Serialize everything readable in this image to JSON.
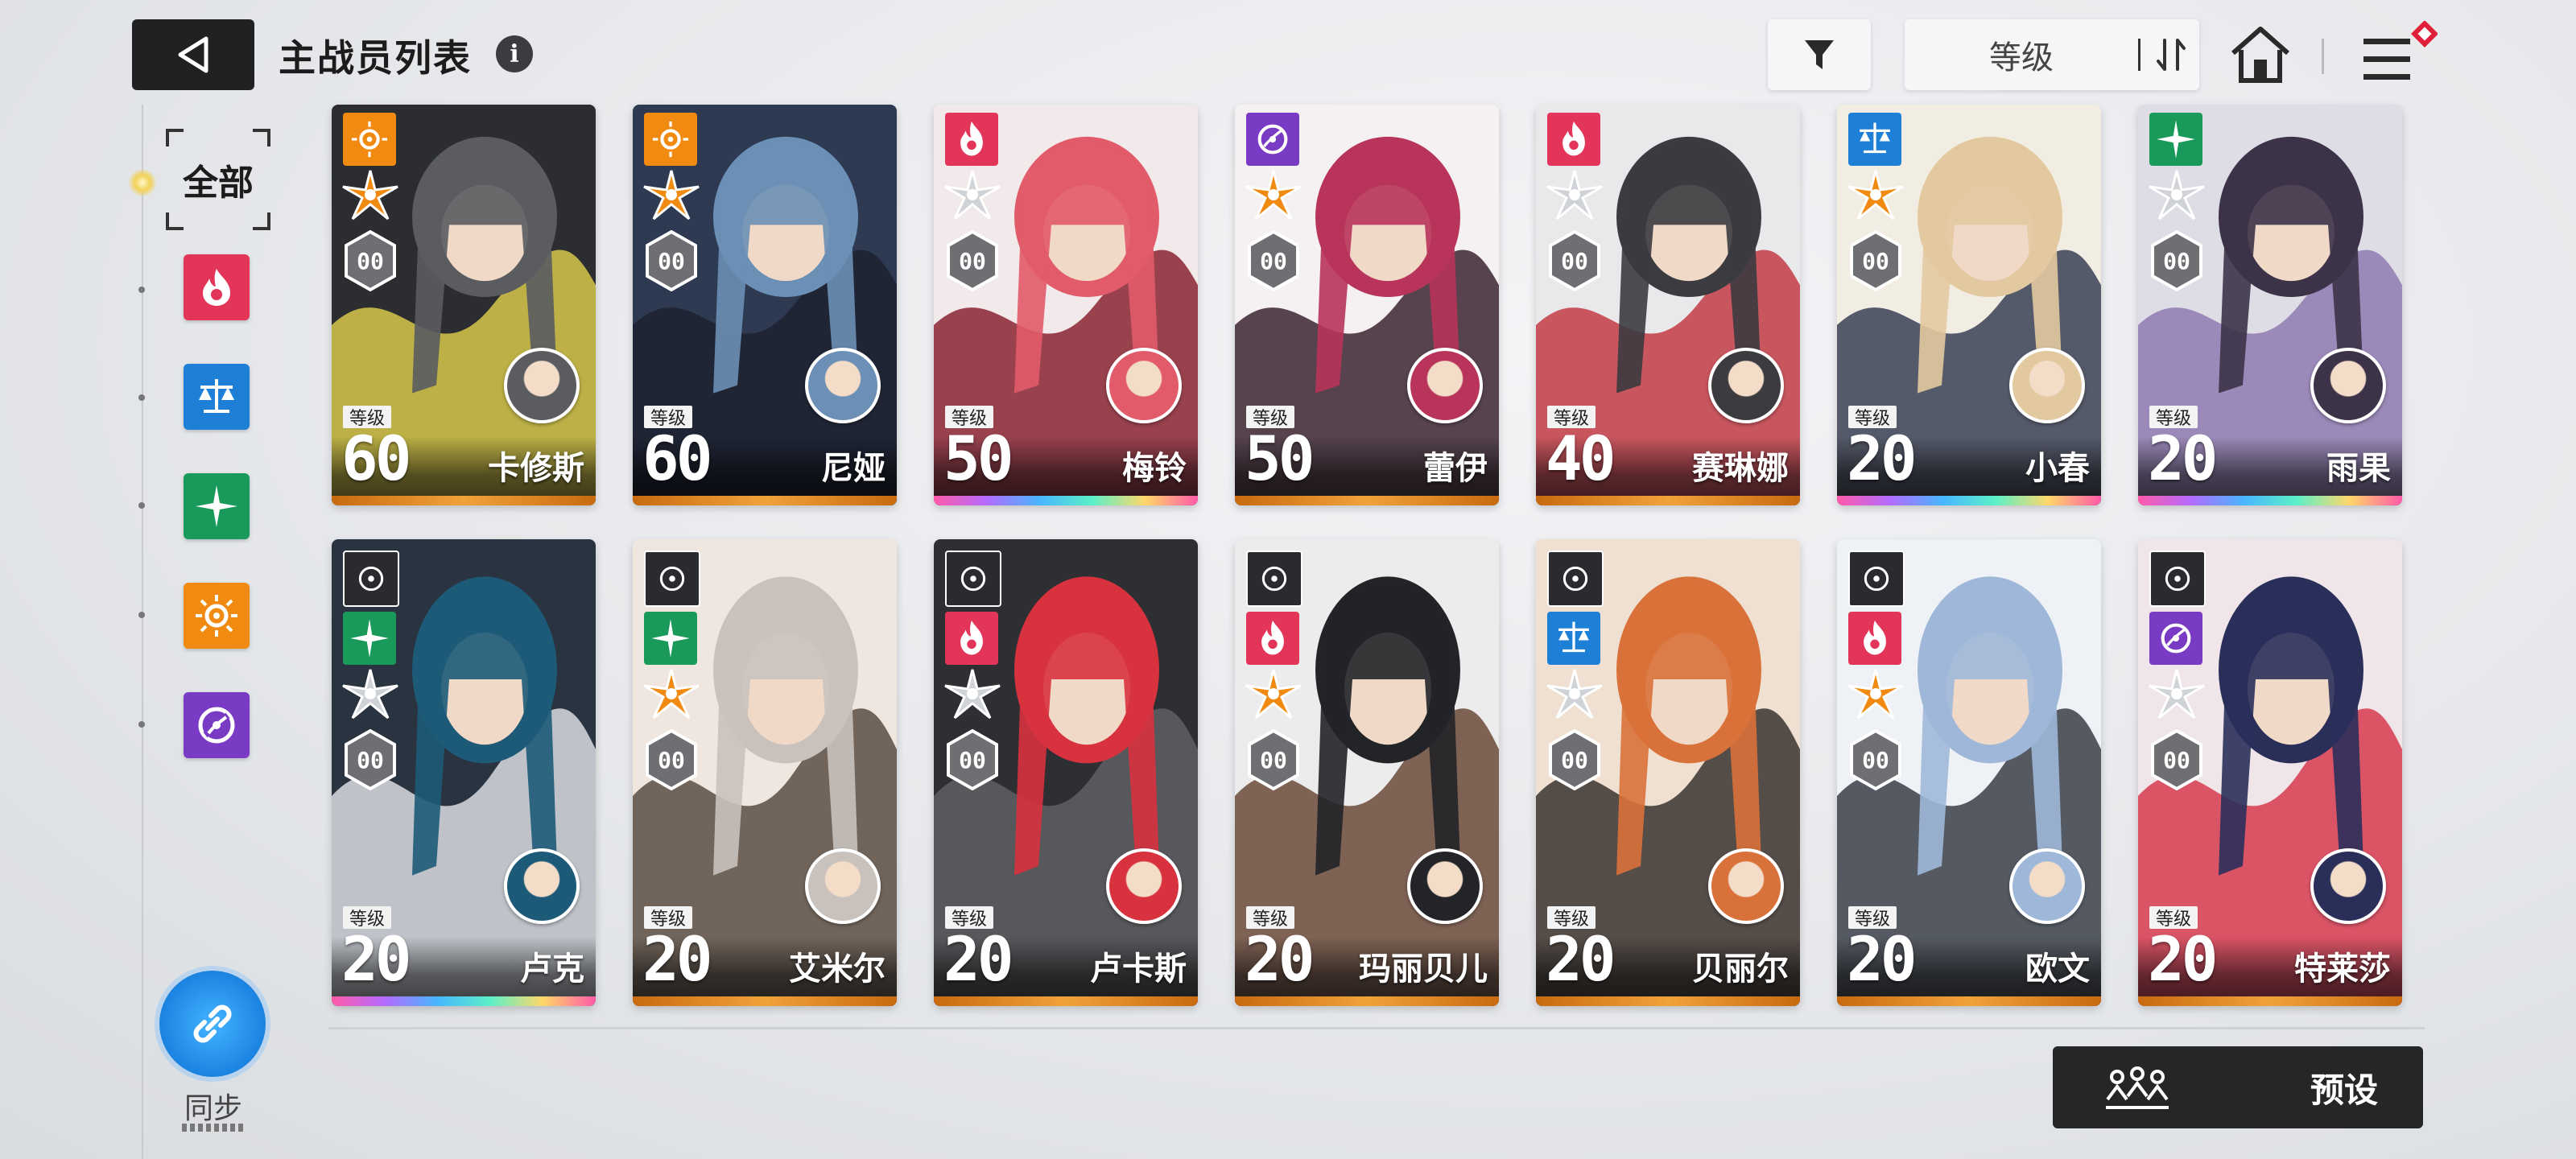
{
  "header": {
    "title": "主战员列表",
    "info_icon": "i",
    "sort_label": "等级"
  },
  "sidebar": {
    "filter_all": "全部",
    "elements": [
      "fire-icon",
      "balance-icon",
      "wind-icon",
      "sun-icon",
      "void-icon"
    ],
    "sync_label": "同步"
  },
  "level_tag": "等级",
  "cards": [
    {
      "name": "卡修斯",
      "level": "60",
      "element": "sun",
      "strip": "gold",
      "hex": "00"
    },
    {
      "name": "尼娅",
      "level": "60",
      "element": "sun",
      "strip": "gold",
      "hex": "00"
    },
    {
      "name": "梅铃",
      "level": "50",
      "element": "fire",
      "strip": "rainbow",
      "hex": "00"
    },
    {
      "name": "蕾伊",
      "level": "50",
      "element": "void",
      "strip": "gold",
      "hex": "00"
    },
    {
      "name": "赛琳娜",
      "level": "40",
      "element": "fire",
      "strip": "gold",
      "hex": "00"
    },
    {
      "name": "小春",
      "level": "20",
      "element": "balance",
      "strip": "rainbow",
      "hex": "00"
    },
    {
      "name": "雨果",
      "level": "20",
      "element": "wind",
      "strip": "rainbow",
      "hex": "00"
    },
    {
      "name": "卢克",
      "level": "20",
      "element": "wind",
      "strip": "rainbow",
      "hex": "00"
    },
    {
      "name": "艾米尔",
      "level": "20",
      "element": "wind",
      "strip": "gold",
      "hex": "00"
    },
    {
      "name": "卢卡斯",
      "level": "20",
      "element": "fire",
      "strip": "gold",
      "hex": "00"
    },
    {
      "name": "玛丽贝儿",
      "level": "20",
      "element": "fire",
      "strip": "gold",
      "hex": "00"
    },
    {
      "name": "贝丽尔",
      "level": "20",
      "element": "balance",
      "strip": "gold",
      "hex": "00"
    },
    {
      "name": "欧文",
      "level": "20",
      "element": "fire",
      "strip": "gold",
      "hex": "00"
    },
    {
      "name": "特莱莎",
      "level": "20",
      "element": "void",
      "strip": "gold",
      "hex": "00"
    }
  ],
  "preset": {
    "label": "预设"
  },
  "colors": {
    "fire": "#e3345a",
    "balance": "#1d7fd6",
    "wind": "#1a9a5a",
    "sun": "#f08a10",
    "void": "#7a3bc4",
    "dark_button": "#1f2123"
  }
}
